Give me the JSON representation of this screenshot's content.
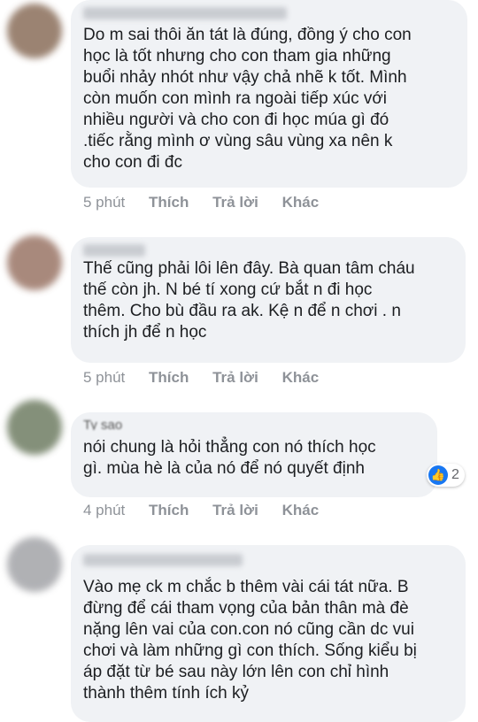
{
  "comments": [
    {
      "text": "Do m sai thôi ăn tát là đúng, đồng ý cho con\nhọc là tốt nhưng cho con tham gia những\nbuổi nhảy nhót như vậy chả nhẽ k tốt. Mình\ncòn muốn con mình ra ngoài tiếp xúc với\nnhiều người và cho con đi học múa gì đó\n.tiếc rằng mình ơ vùng sâu vùng xa nên k\ncho con đi đc",
      "time": "5 phút",
      "like": "Thích",
      "reply": "Trả lời",
      "other": "Khác",
      "avatar_color": "#8a6e5a"
    },
    {
      "text": "Thế cũng phải lôi lên đây. Bà quan tâm cháu\nthế còn jh. N bé tí xong cứ bắt n đi học\nthêm. Cho bù đầu ra ak. Kệ n để n chơi . n\nthích jh để n học",
      "time": "5 phút",
      "like": "Thích",
      "reply": "Trả lời",
      "other": "Khác",
      "avatar_color": "#9a7566"
    },
    {
      "partial_name": "Ty sao",
      "text": "nói chung là hỏi thẳng con nó thích học\ngì. mùa hè là của nó để nó quyết định",
      "time": "4 phút",
      "like": "Thích",
      "reply": "Trả lời",
      "other": "Khác",
      "avatar_color": "#6f7d63",
      "reactions": {
        "count": "2",
        "icon": "thumbs-up-icon"
      }
    },
    {
      "text": "Vào mẹ ck m chắc b thêm vài cái tát nữa. B\nđừng để cái tham vọng của bản thân mà đè\nnặng lên vai của con.con nó cũng cần dc vui\nchơi và làm những gì con thích. Sống kiểu bị\náp đặt từ bé sau này lớn lên con chỉ hình\nthành thêm tính ích kỷ",
      "avatar_color": "#a3a4a8"
    }
  ]
}
